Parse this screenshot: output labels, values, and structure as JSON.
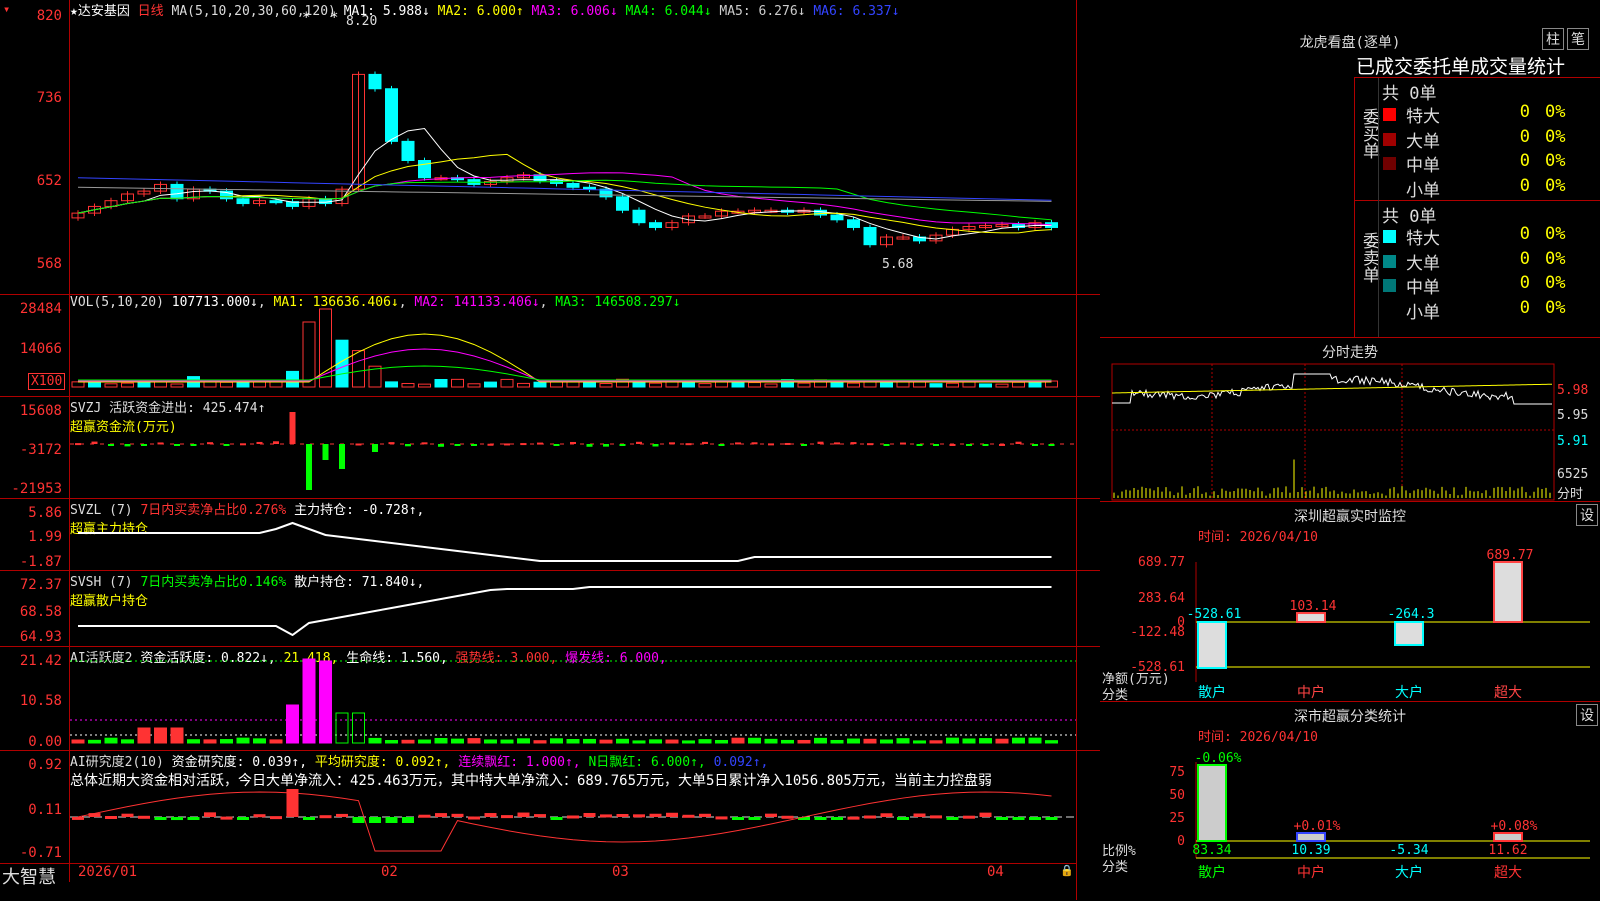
{
  "app": {
    "brand": "大智慧",
    "stock_name": "★达安基因",
    "period": "日线"
  },
  "main": {
    "ma_label": "MA(5,10,20,30,60,120)",
    "ma1": "MA1: 5.988↓",
    "ma2": "MA2: 6.000↑",
    "ma3": "MA3: 6.006↓",
    "ma4": "MA4: 6.044↓",
    "ma5": "MA5: 6.276↓",
    "ma6": "MA6: 6.337↓",
    "y_ticks": [
      "820",
      "736",
      "652",
      "568"
    ],
    "high_marker": "8.20",
    "low_marker": "5.68"
  },
  "vol": {
    "label": "VOL(5,10,20)",
    "value": "107713.000↓",
    "ma1": "MA1: 136636.406↓",
    "ma2": "MA2: 141133.406↓",
    "ma3": "MA3: 146508.297↓",
    "y_ticks": [
      "28484",
      "14066"
    ],
    "unit": "X100"
  },
  "svzj": {
    "label": "SVZJ",
    "title": "活跃资金进出: 425.474↑",
    "subtitle": "超赢资金流(万元)",
    "y_ticks": [
      "15608",
      "-3172",
      "-21953"
    ]
  },
  "svzl": {
    "label": "SVZL (7)",
    "title_a": "7日内买卖净占比0.276%",
    "title_b": "主力持仓: -0.728↑,",
    "subtitle": "超赢主力持仓",
    "y_ticks": [
      "5.86",
      "1.99",
      "-1.87"
    ]
  },
  "svsh": {
    "label": "SVSH (7)",
    "title_a": "7日内买卖净占比0.146%",
    "title_b": "散户持仓: 71.840↓,",
    "subtitle": "超赢散户持仓",
    "y_ticks": [
      "72.37",
      "68.58",
      "64.93"
    ]
  },
  "ai_active": {
    "label": "AI活跃度2",
    "t1": "资金活跃度: 0.822↓,",
    "t2": "21.418,",
    "t3": "生命线: 1.560,",
    "t4": "强势线: 3.000,",
    "t5": "爆发线: 6.000,",
    "y_ticks": [
      "21.42",
      "10.58",
      "0.00"
    ]
  },
  "ai_research": {
    "label": "AI研究度2(10)",
    "t1": "资金研究度: 0.039↑,",
    "t2": "平均研究度: 0.092↑,",
    "t3": "连续飘红: 1.000↑,",
    "t4": "N日飘红: 6.000↑,",
    "t5": "0.092↑,",
    "summary": "总体近期大资金相对活跃，今日大单净流入：425.463万元，其中特大单净流入：689.765万元，大单5日累计净入1056.805万元，当前主力控盘弱",
    "y_ticks": [
      "0.92",
      "0.11",
      "-0.71"
    ]
  },
  "x_axis": [
    "2026/01",
    "02",
    "03",
    "04"
  ],
  "dragon": {
    "title": "龙虎看盘(逐单)",
    "btn_a": "柱",
    "btn_b": "笔",
    "subtitle": "已成交委托单成交量统计",
    "buy_side": "委买单",
    "sell_side": "委卖单",
    "buy_total": "共 0单",
    "sell_total": "共 0单",
    "buy_rows": [
      {
        "name": "特大",
        "count": "0",
        "pct": "0%",
        "color": "#ff0000"
      },
      {
        "name": "大单",
        "count": "0",
        "pct": "0%",
        "color": "#a00000"
      },
      {
        "name": "中单",
        "count": "0",
        "pct": "0%",
        "color": "#700000"
      },
      {
        "name": "小单",
        "count": "0",
        "pct": "0%",
        "color": ""
      }
    ],
    "sell_rows": [
      {
        "name": "特大",
        "count": "0",
        "pct": "0%",
        "color": "#00ffff"
      },
      {
        "name": "大单",
        "count": "0",
        "pct": "0%",
        "color": "#008888"
      },
      {
        "name": "中单",
        "count": "0",
        "pct": "0%",
        "color": "#007777"
      },
      {
        "name": "小单",
        "count": "0",
        "pct": "0%",
        "color": ""
      }
    ]
  },
  "intraday": {
    "title": "分时走势",
    "prices": [
      "5.98",
      "5.95",
      "5.91"
    ],
    "vol": "6525",
    "vol_unit": "分时"
  },
  "sz_monitor": {
    "title": "深圳超赢实时监控",
    "btn": "设",
    "time": "时间: 2026/04/10",
    "y_ticks": [
      "689.77",
      "283.64",
      "0",
      "-122.48",
      "-528.61"
    ],
    "ylabel": "净额(万元)",
    "xlabel": "分类",
    "categories": [
      "散户",
      "中户",
      "大户",
      "超大"
    ],
    "values": [
      "-528.61",
      "103.14",
      "-264.3",
      "689.77"
    ]
  },
  "sz_class": {
    "title": "深市超赢分类统计",
    "btn": "设",
    "time": "时间: 2026/04/10",
    "y_ticks": [
      "75",
      "50",
      "25",
      "0"
    ],
    "ylabel": "比例%",
    "xlabel": "分类",
    "categories": [
      "散户",
      "中户",
      "大户",
      "超大"
    ],
    "top_labels": [
      "-0.06%",
      "+0.01%",
      "",
      "+0.08%"
    ],
    "values": [
      "83.34",
      "10.39",
      "-5.34",
      "11.62"
    ]
  },
  "chart_data": [
    {
      "type": "bar",
      "title": "深圳超赢实时监控",
      "categories": [
        "散户",
        "中户",
        "大户",
        "超大"
      ],
      "values": [
        -528.61,
        103.14,
        -264.3,
        689.77
      ],
      "ylabel": "净额(万元)",
      "xlabel": "分类"
    },
    {
      "type": "bar",
      "title": "深市超赢分类统计",
      "categories": [
        "散户",
        "中户",
        "大户",
        "超大"
      ],
      "values": [
        83.34,
        10.39,
        -5.34,
        11.62
      ],
      "ylabel": "比例%",
      "xlabel": "分类"
    }
  ]
}
